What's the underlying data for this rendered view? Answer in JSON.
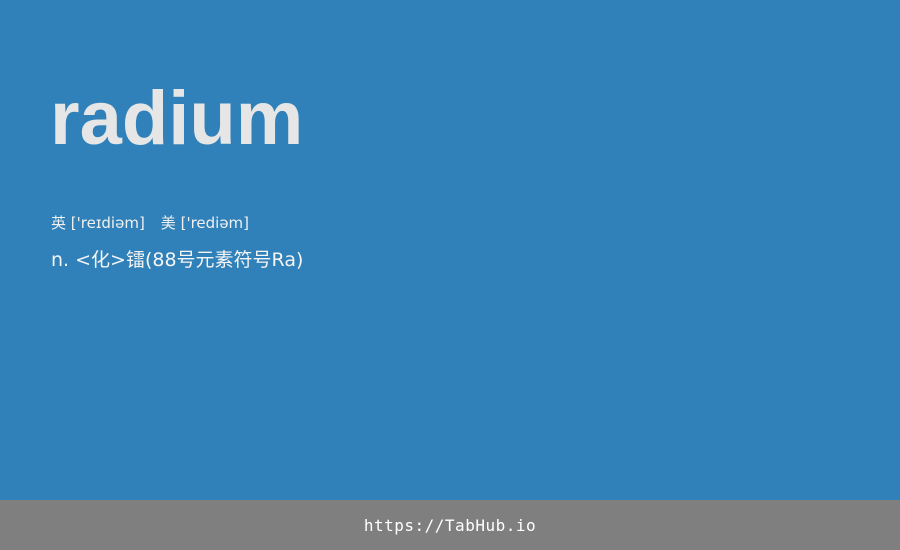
{
  "card": {
    "word": "radium",
    "phonetic_uk_label": "英",
    "phonetic_uk": "['reɪdiəm]",
    "phonetic_us_label": "美",
    "phonetic_us": "['rediəm]",
    "definition": "n. <化>镭(88号元素符号Ra)"
  },
  "footer": {
    "link_text": "https://TabHub.io"
  },
  "colors": {
    "background": "#3081b9",
    "footer": "#7f7f7f",
    "word": "#e6e6e6"
  }
}
